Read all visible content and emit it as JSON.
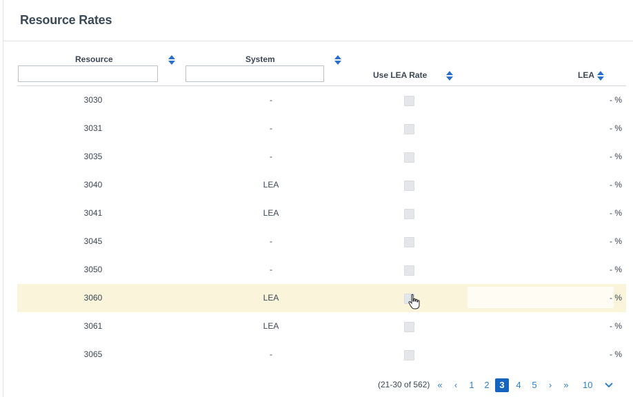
{
  "title": "Resource Rates",
  "columns": {
    "resource": "Resource",
    "system": "System",
    "use_lea_rate": "Use LEA Rate",
    "lea": "LEA"
  },
  "filters": {
    "resource": "",
    "system": ""
  },
  "rows": [
    {
      "resource": "3030",
      "system": "-",
      "use_lea_rate": false,
      "lea": "- %"
    },
    {
      "resource": "3031",
      "system": "-",
      "use_lea_rate": false,
      "lea": "- %"
    },
    {
      "resource": "3035",
      "system": "-",
      "use_lea_rate": false,
      "lea": "- %"
    },
    {
      "resource": "3040",
      "system": "LEA",
      "use_lea_rate": false,
      "lea": "- %"
    },
    {
      "resource": "3041",
      "system": "LEA",
      "use_lea_rate": false,
      "lea": "- %"
    },
    {
      "resource": "3045",
      "system": "-",
      "use_lea_rate": false,
      "lea": "- %"
    },
    {
      "resource": "3050",
      "system": "-",
      "use_lea_rate": false,
      "lea": "- %"
    },
    {
      "resource": "3060",
      "system": "LEA",
      "use_lea_rate": false,
      "lea": "- %"
    },
    {
      "resource": "3061",
      "system": "LEA",
      "use_lea_rate": false,
      "lea": "- %"
    },
    {
      "resource": "3065",
      "system": "-",
      "use_lea_rate": false,
      "lea": "- %"
    }
  ],
  "highlighted_row": 7,
  "pagination": {
    "info": "(21-30 of 562)",
    "first": "«",
    "prev": "‹",
    "pages": [
      "1",
      "2",
      "3",
      "4",
      "5"
    ],
    "current_page": "3",
    "next": "›",
    "last": "»",
    "page_size": "10"
  },
  "colors": {
    "accent": "#1565c0",
    "link": "#2d7fd3",
    "highlight_row": "#faf4da"
  },
  "icons": {
    "sort": "sort-icon",
    "page_size_toggle": "chevron-down-icon",
    "cursor": "hand-pointer-icon"
  }
}
